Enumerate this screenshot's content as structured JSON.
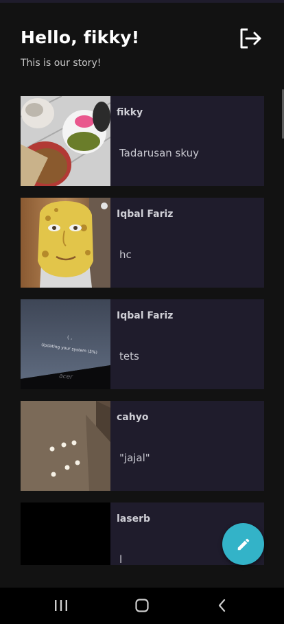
{
  "header": {
    "title": "Hello, fikky!",
    "subtitle": "This is our story!",
    "logout_icon": "logout-icon"
  },
  "stories": [
    {
      "name": "fikky",
      "description": "Tadarusan skuy",
      "thumbnail": "food-plates-photo"
    },
    {
      "name": "Iqbal Fariz",
      "description": "hc",
      "thumbnail": "sponge-face-photo"
    },
    {
      "name": "Iqbal Fariz",
      "description": "tets",
      "thumbnail": "laptop-update-screen-photo"
    },
    {
      "name": "cahyo",
      "description": "\"jajal\"",
      "thumbnail": "room-wall-lights-photo"
    },
    {
      "name": "laserb",
      "description": "l",
      "thumbnail": "black-photo"
    }
  ],
  "updating_text": "Updating your system (5%)",
  "laptop_brand": "acer",
  "fab": {
    "icon": "pencil-icon"
  },
  "nav": {
    "icons": [
      "recents-icon",
      "home-icon",
      "back-icon"
    ]
  },
  "colors": {
    "background": "#121212",
    "card": "#1f1c2c",
    "accent": "#33b3c8"
  }
}
